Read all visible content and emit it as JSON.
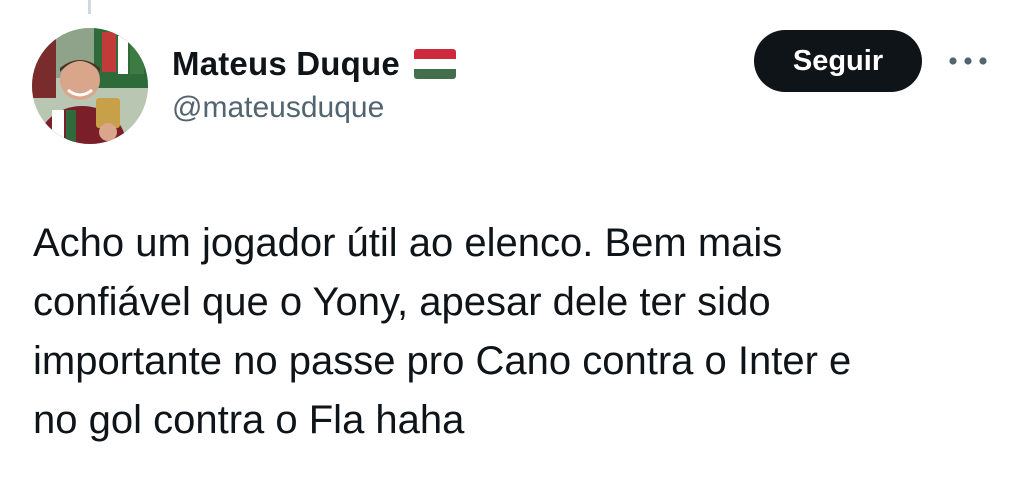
{
  "author": {
    "display_name": "Mateus Duque",
    "handle": "@mateusduque",
    "flag_icon": "hungary-flag-icon",
    "flag_colors": [
      "#cd2a3e",
      "#ffffff",
      "#436f4d"
    ]
  },
  "actions": {
    "follow_label": "Seguir",
    "more_icon": "more-horizontal-icon"
  },
  "tweet": {
    "lines": [
      "Acho um jogador útil ao elenco. Bem mais",
      "confiável que o Yony, apesar dele ter sido",
      "importante no passe pro Cano contra o Inter e",
      "no gol contra o Fla haha"
    ]
  },
  "colors": {
    "text_primary": "#0f1419",
    "text_secondary": "#536471",
    "button_bg": "#0f1419",
    "button_text": "#ffffff"
  }
}
